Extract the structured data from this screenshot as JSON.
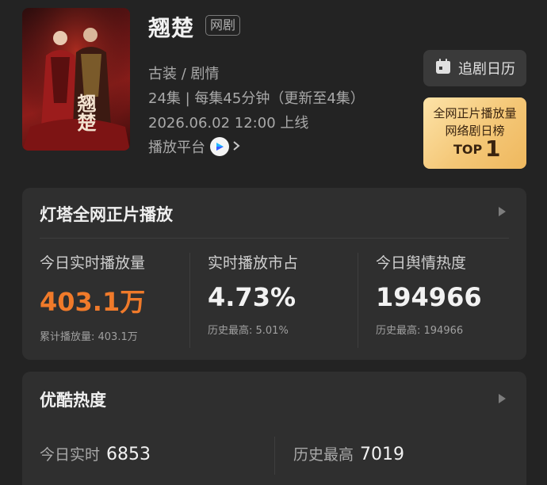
{
  "drama": {
    "poster_title_art": "翘楚",
    "title": "翘楚",
    "tag": "网剧",
    "genre": "古装 / 剧情",
    "episodes": "24集 | 每集45分钟（更新至4集）",
    "release": "2026.06.02 12:00 上线",
    "platform_label": "播放平台",
    "platform_icon": "youku-logo-icon"
  },
  "calendar_button": {
    "label": "追剧日历",
    "icon": "calendar-icon"
  },
  "rank_badge": {
    "line1": "全网正片播放量",
    "line2": "网络剧日榜",
    "top_label": "TOP",
    "rank": "1"
  },
  "tower_card": {
    "title": "灯塔全网正片播放",
    "stats": [
      {
        "label": "今日实时播放量",
        "value": "403.1万",
        "sub": "累计播放量: 403.1万",
        "highlight": true
      },
      {
        "label": "实时播放市占",
        "value": "4.73%",
        "sub": "历史最高: 5.01%",
        "highlight": false
      },
      {
        "label": "今日舆情热度",
        "value": "194966",
        "sub": "历史最高: 194966",
        "highlight": false
      }
    ],
    "accent_color": "#f07a2a"
  },
  "youku_card": {
    "title": "优酷热度",
    "today_label": "今日实时",
    "today_value": "6853",
    "max_label": "历史最高",
    "max_value": "7019"
  }
}
